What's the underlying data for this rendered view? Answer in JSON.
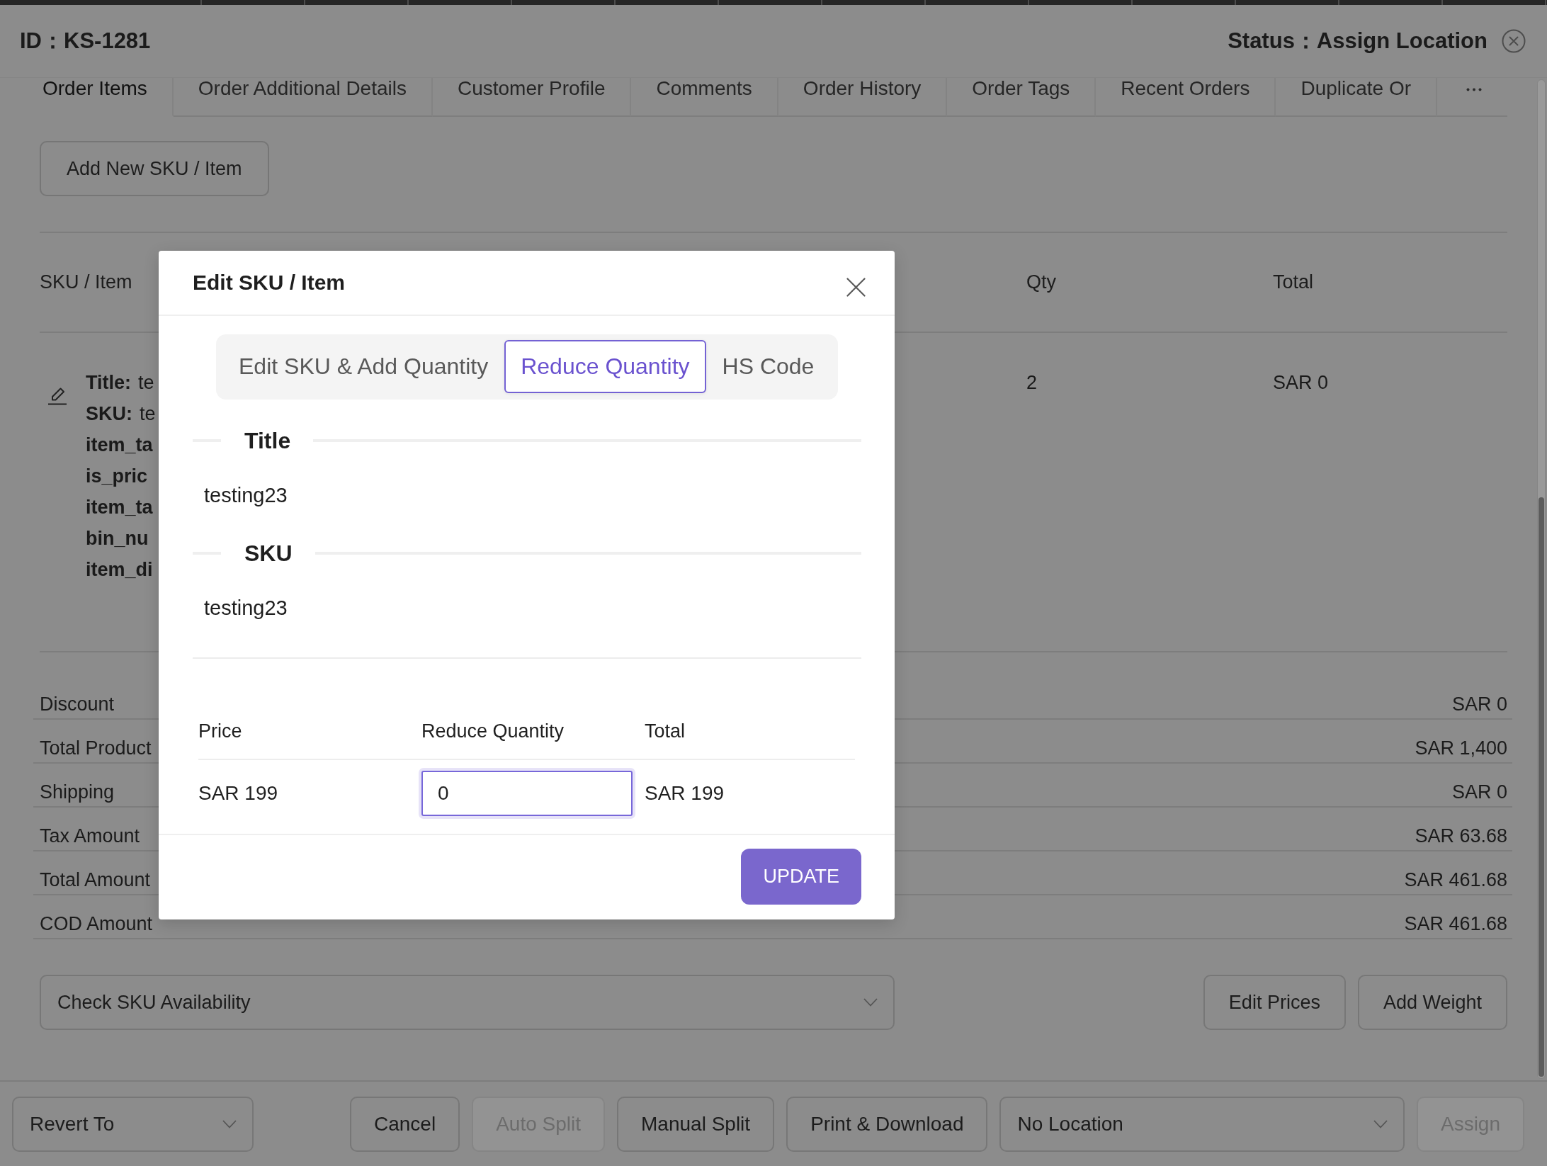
{
  "header": {
    "order_id": "ID：KS-1281",
    "status": "Status：Assign Location"
  },
  "tabs": [
    {
      "label": "Order Items",
      "selected": true
    },
    {
      "label": "Order Additional Details",
      "selected": false
    },
    {
      "label": "Customer Profile",
      "selected": false
    },
    {
      "label": "Comments",
      "selected": false
    },
    {
      "label": "Order History",
      "selected": false
    },
    {
      "label": "Order Tags",
      "selected": false
    },
    {
      "label": "Recent Orders",
      "selected": false
    },
    {
      "label": "Duplicate Or",
      "selected": false
    }
  ],
  "order_items": {
    "add_button": "Add New SKU / Item",
    "columns": [
      "SKU / Item",
      "Qty",
      "Total"
    ],
    "rows": [
      {
        "details": [
          {
            "label": "Title:",
            "value": "te"
          },
          {
            "label": "SKU:",
            "value": "te"
          },
          {
            "label": "item_ta"
          },
          {
            "label": "is_pric"
          },
          {
            "label": "item_ta"
          },
          {
            "label": "bin_nu"
          },
          {
            "label": "item_di"
          }
        ],
        "qty": "2",
        "total": "SAR 0"
      }
    ]
  },
  "summary": [
    {
      "label": "Discount",
      "value": "SAR 0"
    },
    {
      "label": "Total Product",
      "value": "SAR 1,400"
    },
    {
      "label": "Shipping",
      "value": "SAR 0"
    },
    {
      "label": "Tax Amount",
      "value": "SAR 63.68"
    },
    {
      "label": "Total Amount",
      "value": "SAR 461.68"
    },
    {
      "label": "COD Amount",
      "value": "SAR 461.68"
    }
  ],
  "availability": {
    "select": {
      "value": "Check SKU Availability"
    },
    "buttons": [
      "Edit Prices",
      "Add Weight"
    ]
  },
  "footer": {
    "controls": [
      {
        "kind": "select",
        "value": "Revert To"
      },
      {
        "kind": "button",
        "label": "Cancel",
        "disabled": false
      },
      {
        "kind": "button",
        "label": "Auto Split",
        "disabled": true
      },
      {
        "kind": "button",
        "label": "Manual Split",
        "disabled": false
      },
      {
        "kind": "button",
        "label": "Print & Download",
        "disabled": false
      },
      {
        "kind": "select",
        "value": "No Location"
      },
      {
        "kind": "button",
        "label": "Assign",
        "disabled": true
      }
    ]
  },
  "modal": {
    "title": "Edit SKU / Item",
    "tabs": [
      {
        "label": "Edit SKU & Add Quantity",
        "selected": false
      },
      {
        "label": "Reduce Quantity",
        "selected": true
      },
      {
        "label": "HS Code",
        "selected": false
      }
    ],
    "sections": [
      {
        "heading": "Title",
        "value": "testing23"
      },
      {
        "heading": "SKU",
        "value": "testing23"
      }
    ],
    "table": {
      "columns": [
        "Price",
        "Reduce Quantity",
        "Total"
      ],
      "rows": [
        {
          "price": "SAR 199",
          "quantity": {
            "value": "0",
            "focused": true
          },
          "total": "SAR 199"
        }
      ]
    },
    "submit_button": "UPDATE"
  }
}
